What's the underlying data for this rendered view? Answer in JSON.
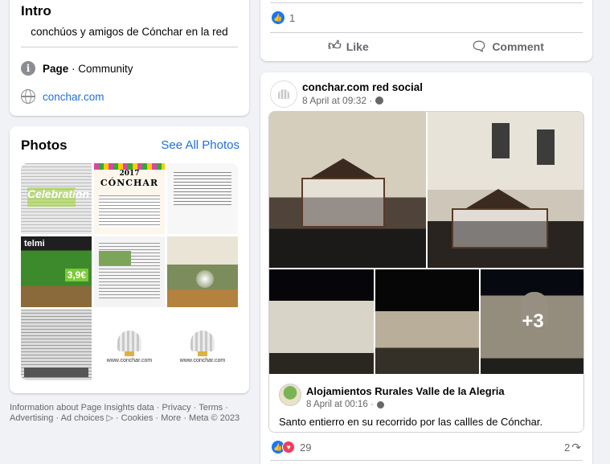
{
  "intro": {
    "title": "Intro",
    "bio": "conchúos y amigos de Cónchar en la red",
    "category_prefix": "Page",
    "category_suffix": " · Community",
    "website": "conchar.com"
  },
  "photos": {
    "title": "Photos",
    "see_all": "See All Photos",
    "thumbs": [
      {
        "name": "flyer-blue-highlight",
        "text": "Celebration"
      },
      {
        "name": "fiestas-poster",
        "year": "2017",
        "title": "CÓNCHAR",
        "subtitle": "Fiestas patronales de San Roque"
      },
      {
        "name": "document-page"
      },
      {
        "name": "telmi-ad",
        "brand": "telmi",
        "price": "3,9€"
      },
      {
        "name": "notice-document"
      },
      {
        "name": "mountain-landscape"
      },
      {
        "name": "grey-document"
      },
      {
        "name": "conchar-logo-1",
        "url": "www.conchar.com"
      },
      {
        "name": "conchar-logo-2",
        "url": "www.conchar.com"
      }
    ]
  },
  "footer": {
    "line1": "Information about Page Insights data · Privacy · Terms ·",
    "line2": "Advertising · Ad choices ▷ · Cookies · More · Meta © 2023"
  },
  "post_top": {
    "reaction_count": "1",
    "like_label": "Like",
    "comment_label": "Comment"
  },
  "post": {
    "author": "conchar.com red social",
    "timestamp": "8 April at 09:32 ·",
    "shared": {
      "author": "Alojamientos Rurales Valle de la Alegria",
      "timestamp": "8 April at 00:16 ·",
      "text": "Santo entierro en su recorrido por las callles de Cónchar.",
      "more_photos": "+3"
    },
    "reaction_count": "29",
    "share_count": "2"
  },
  "colors": {
    "accent": "#216fdb",
    "background": "#f0f2f5",
    "like": "#1877f2",
    "love": "#f33e58"
  }
}
